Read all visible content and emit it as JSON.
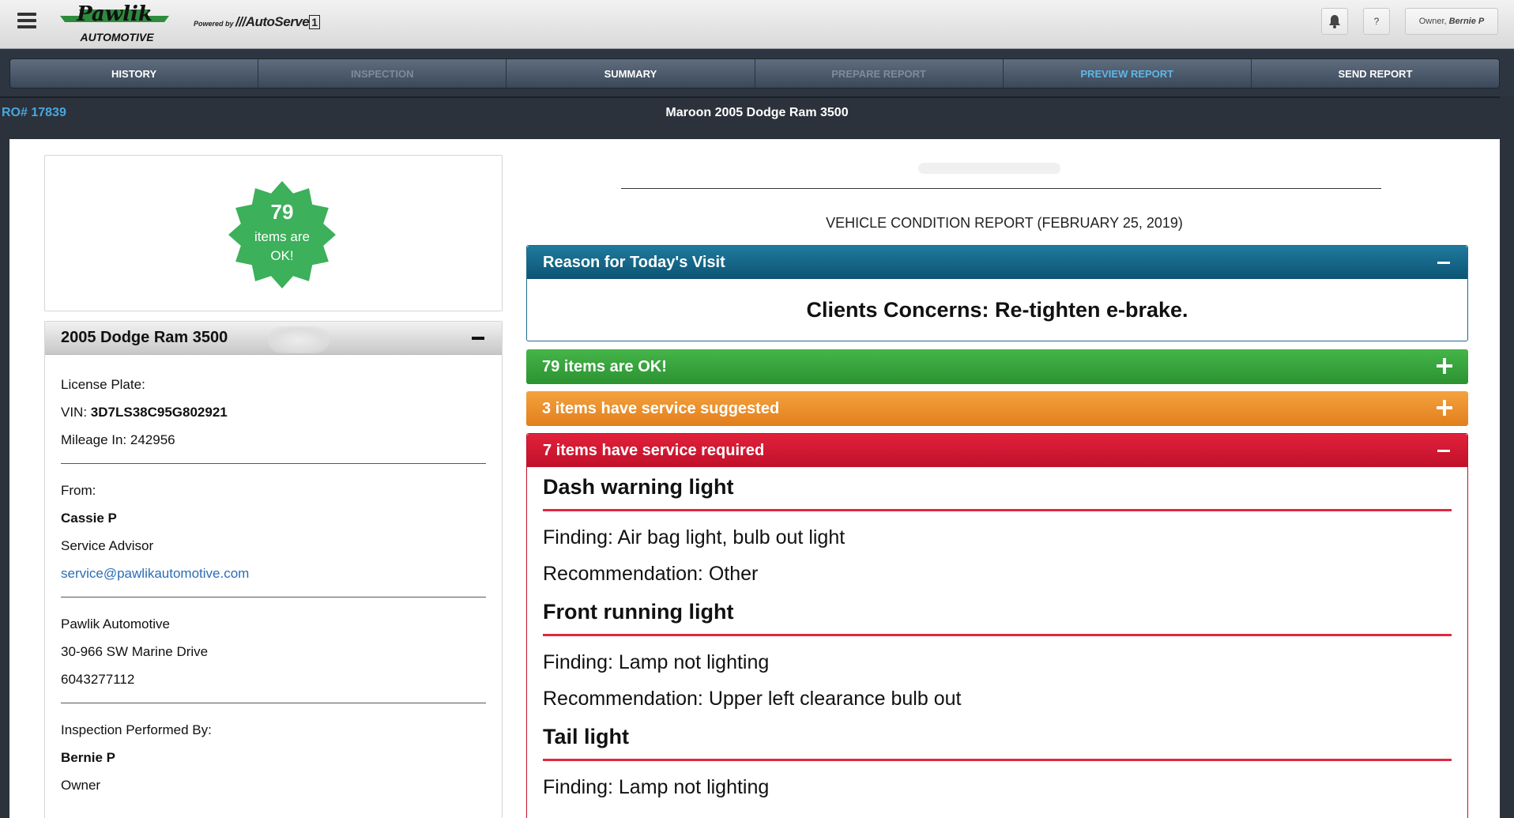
{
  "header": {
    "logo_text_top": "Pawlik",
    "logo_text_bottom": "AUTOMOTIVE",
    "powered_by": "Powered by",
    "powered_brand": "AutoServe",
    "powered_brand_suffix": "1",
    "help_label": "?",
    "owner_role": "Owner,",
    "owner_name": "Bernie P"
  },
  "nav": {
    "items": [
      {
        "label": "HISTORY",
        "state": "normal"
      },
      {
        "label": "INSPECTION",
        "state": "disabled"
      },
      {
        "label": "SUMMARY",
        "state": "normal"
      },
      {
        "label": "PREPARE REPORT",
        "state": "disabled"
      },
      {
        "label": "PREVIEW REPORT",
        "state": "active"
      },
      {
        "label": "SEND REPORT",
        "state": "normal"
      }
    ]
  },
  "ro": {
    "number": "RO# 17839",
    "vehicle_title": "Maroon 2005 Dodge Ram 3500"
  },
  "badge": {
    "count": "79",
    "label": "items are OK!",
    "color": "#3cb05a"
  },
  "vehicle": {
    "title": "2005 Dodge Ram 3500",
    "license_label": "License Plate:",
    "vin_label": "VIN:",
    "vin": "3D7LS38C95G802921",
    "mileage": "Mileage In: 242956",
    "from_label": "From:",
    "advisor_name": "Cassie P",
    "advisor_role": "Service Advisor",
    "advisor_email": "service@pawlikautomotive.com",
    "shop_name": "Pawlik Automotive",
    "shop_address": "30-966 SW Marine Drive",
    "shop_phone": "6043277112",
    "inspector_label": "Inspection Performed By:",
    "inspector_name": "Bernie P",
    "inspector_role": "Owner"
  },
  "report": {
    "title": "VEHICLE CONDITION REPORT (FEBRUARY 25, 2019)",
    "reason_header": "Reason for Today's Visit",
    "reason_body": "Clients Concerns: Re-tighten e-brake.",
    "ok_header": "79 items are OK!",
    "suggested_header": "3 items have service suggested",
    "required_header": "7 items have service required",
    "required_items": [
      {
        "name": "Dash warning light",
        "finding": "Finding: Air bag light, bulb out light",
        "recommendation": "Recommendation: Other"
      },
      {
        "name": "Front running light",
        "finding": "Finding: Lamp not lighting",
        "recommendation": "Recommendation: Upper left clearance bulb out"
      },
      {
        "name": "Tail light",
        "finding": "Finding: Lamp not lighting",
        "recommendation": ""
      }
    ]
  }
}
